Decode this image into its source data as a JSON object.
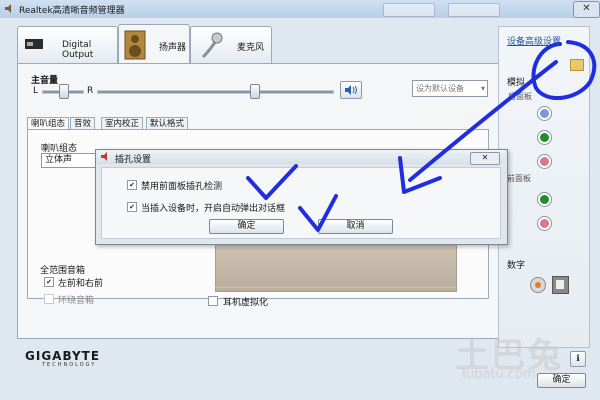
{
  "window": {
    "title": "Realtek高清晰音频管理器",
    "close": "✕"
  },
  "device_tabs": [
    {
      "label": "Digital Output"
    },
    {
      "label": "扬声器"
    },
    {
      "label": "麦克风"
    }
  ],
  "volume": {
    "label": "主音量",
    "left": "L",
    "right": "R",
    "balance": 0.5,
    "level": 0.68,
    "default_device_placeholder": "设为默认设备"
  },
  "inner_tabs": [
    "喇叭组态",
    "音效",
    "室内校正",
    "默认格式"
  ],
  "speaker_config": {
    "label": "喇叭组态",
    "value": "立体声"
  },
  "full_range": {
    "label": "全范围音箱",
    "front_lr": "左前和右前",
    "front_lr_checked": true,
    "surround": "环绕音箱",
    "surround_checked": false
  },
  "virtualization": {
    "label": "耳机虚拟化",
    "checked": false
  },
  "right_panel": {
    "advanced_link": "设备高级设置",
    "analog_label": "模拟",
    "rear_label": "后面板",
    "front_label": "前面板",
    "digital_label": "数字",
    "rear_jacks": [
      {
        "color": "#7a9ad6"
      },
      {
        "color": "#1e8f2e"
      },
      {
        "color": "#d87a8a"
      }
    ],
    "front_jacks": [
      {
        "color": "#1e8f2e"
      },
      {
        "color": "#d87a8a"
      }
    ]
  },
  "branding": {
    "logo": "GIGABYTE",
    "sub": "TECHNOLOGY"
  },
  "ok_button": "确定",
  "watermark": {
    "main": "土巴兔",
    "sub": "Tubatu.com"
  },
  "modal": {
    "title": "插孔设置",
    "close": "✕",
    "options": [
      {
        "label": "禁用前面板插孔检测",
        "checked": true
      },
      {
        "label": "当插入设备时，开启自动弹出对话框",
        "checked": true
      }
    ],
    "ok": "确定",
    "cancel": "取消"
  },
  "colors": {
    "annotation": "#1f2fe0",
    "accent": "#2556a8"
  }
}
